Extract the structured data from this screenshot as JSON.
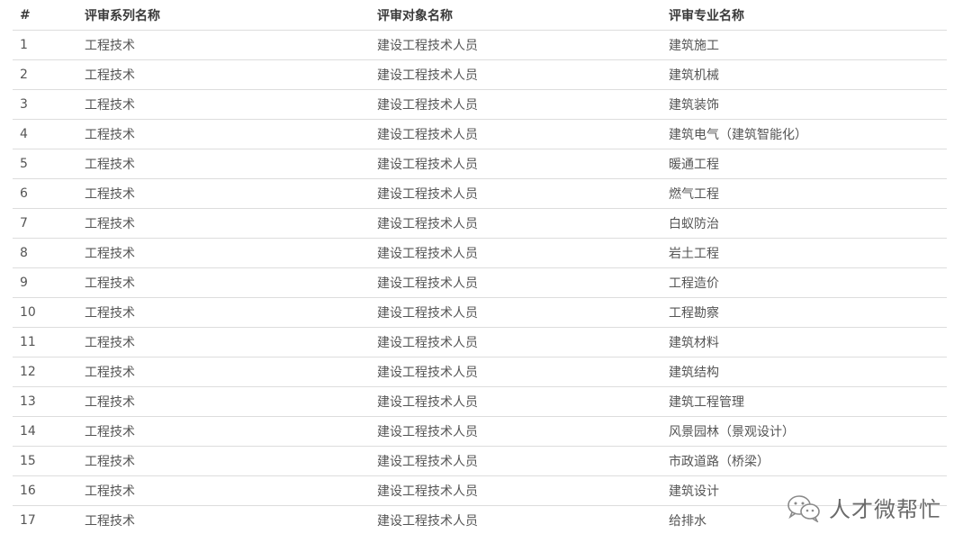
{
  "table": {
    "headers": [
      "#",
      "评审系列名称",
      "评审对象名称",
      "评审专业名称"
    ],
    "rows": [
      [
        "1",
        "工程技术",
        "建设工程技术人员",
        "建筑施工"
      ],
      [
        "2",
        "工程技术",
        "建设工程技术人员",
        "建筑机械"
      ],
      [
        "3",
        "工程技术",
        "建设工程技术人员",
        "建筑装饰"
      ],
      [
        "4",
        "工程技术",
        "建设工程技术人员",
        "建筑电气（建筑智能化）"
      ],
      [
        "5",
        "工程技术",
        "建设工程技术人员",
        "暖通工程"
      ],
      [
        "6",
        "工程技术",
        "建设工程技术人员",
        "燃气工程"
      ],
      [
        "7",
        "工程技术",
        "建设工程技术人员",
        "白蚁防治"
      ],
      [
        "8",
        "工程技术",
        "建设工程技术人员",
        "岩土工程"
      ],
      [
        "9",
        "工程技术",
        "建设工程技术人员",
        "工程造价"
      ],
      [
        "10",
        "工程技术",
        "建设工程技术人员",
        "工程勘察"
      ],
      [
        "11",
        "工程技术",
        "建设工程技术人员",
        "建筑材料"
      ],
      [
        "12",
        "工程技术",
        "建设工程技术人员",
        "建筑结构"
      ],
      [
        "13",
        "工程技术",
        "建设工程技术人员",
        "建筑工程管理"
      ],
      [
        "14",
        "工程技术",
        "建设工程技术人员",
        "风景园林（景观设计）"
      ],
      [
        "15",
        "工程技术",
        "建设工程技术人员",
        "市政道路（桥梁）"
      ],
      [
        "16",
        "工程技术",
        "建设工程技术人员",
        "建筑设计"
      ],
      [
        "17",
        "工程技术",
        "建设工程技术人员",
        "给排水"
      ]
    ]
  },
  "watermark": {
    "text": "人才微帮忙",
    "icon": "wechat-icon"
  }
}
